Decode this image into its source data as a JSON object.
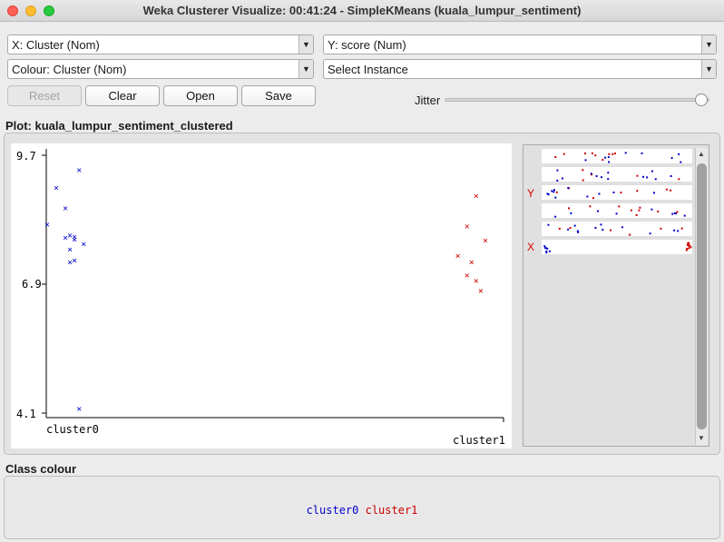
{
  "window": {
    "title": "Weka Clusterer Visualize: 00:41:24 - SimpleKMeans (kuala_lumpur_sentiment)"
  },
  "controls": {
    "x_axis": "X: Cluster (Nom)",
    "y_axis": "Y: score (Num)",
    "colour": "Colour: Cluster (Nom)",
    "instance": "Select Instance",
    "reset_label": "Reset",
    "clear_label": "Clear",
    "open_label": "Open",
    "save_label": "Save",
    "jitter_label": "Jitter",
    "jitter_value": 0.97
  },
  "plot": {
    "title": "Plot: kuala_lumpur_sentiment_clustered",
    "y_labels": [
      "9.7",
      "6.9",
      "4.1"
    ],
    "x_labels": [
      "cluster0",
      "cluster1"
    ],
    "axis_letter_y": "Y",
    "axis_letter_x": "X"
  },
  "chart_data": {
    "type": "scatter",
    "title": "",
    "xlabel": "Cluster",
    "ylabel": "score",
    "ylim": [
      4.1,
      9.7
    ],
    "categories": [
      "cluster0",
      "cluster1"
    ],
    "series": [
      {
        "name": "cluster0",
        "color": "#0000cc",
        "marker": "x",
        "points": [
          {
            "x": 0.0,
            "y": 8.2
          },
          {
            "x": 0.02,
            "y": 9.0
          },
          {
            "x": 0.04,
            "y": 8.56
          },
          {
            "x": 0.04,
            "y": 7.92
          },
          {
            "x": 0.05,
            "y": 7.66
          },
          {
            "x": 0.05,
            "y": 7.96
          },
          {
            "x": 0.06,
            "y": 7.88
          },
          {
            "x": 0.06,
            "y": 7.94
          },
          {
            "x": 0.06,
            "y": 7.42
          },
          {
            "x": 0.05,
            "y": 7.38
          },
          {
            "x": 0.07,
            "y": 9.38
          },
          {
            "x": 0.08,
            "y": 7.78
          },
          {
            "x": 0.07,
            "y": 4.2
          }
        ]
      },
      {
        "name": "cluster1",
        "color": "#cc0000",
        "marker": "x",
        "points": [
          {
            "x": 0.94,
            "y": 8.82
          },
          {
            "x": 0.92,
            "y": 8.16
          },
          {
            "x": 0.96,
            "y": 7.86
          },
          {
            "x": 0.9,
            "y": 7.52
          },
          {
            "x": 0.93,
            "y": 7.38
          },
          {
            "x": 0.92,
            "y": 7.1
          },
          {
            "x": 0.94,
            "y": 6.98
          },
          {
            "x": 0.95,
            "y": 6.76
          }
        ]
      }
    ],
    "legend": [
      "cluster0",
      "cluster1"
    ]
  },
  "class_colour": {
    "title": "Class colour",
    "items": [
      {
        "label": "cluster0",
        "color": "#0000cc"
      },
      {
        "label": "cluster1",
        "color": "#cc0000"
      }
    ]
  }
}
